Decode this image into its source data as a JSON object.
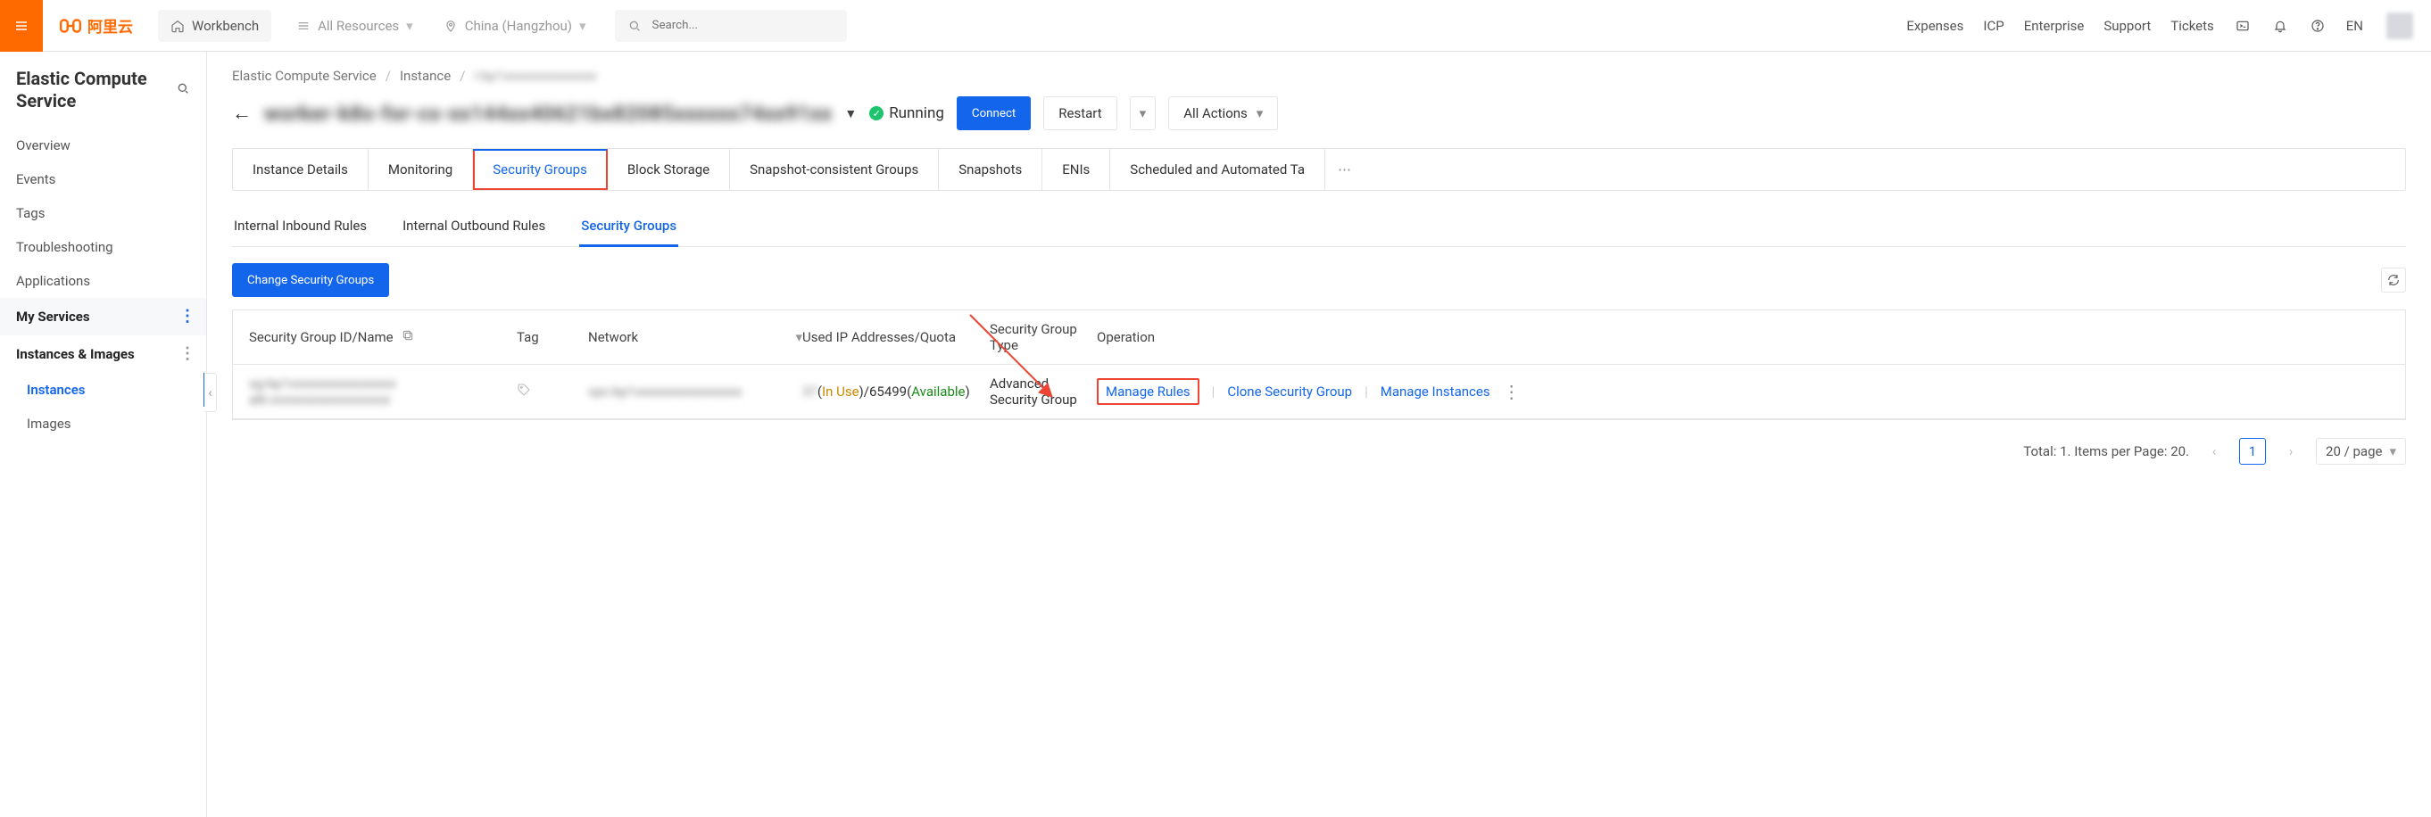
{
  "top": {
    "brand": "阿里云",
    "workbench": "Workbench",
    "all_resources": "All Resources",
    "region": "China (Hangzhou)",
    "search_placeholder": "Search...",
    "nav": {
      "expenses": "Expenses",
      "icp": "ICP",
      "enterprise": "Enterprise",
      "support": "Support",
      "tickets": "Tickets",
      "lang": "EN"
    }
  },
  "sidebar": {
    "title": "Elastic Compute Service",
    "items": {
      "overview": "Overview",
      "events": "Events",
      "tags": "Tags",
      "troubleshooting": "Troubleshooting",
      "applications": "Applications"
    },
    "my_services": "My Services",
    "instances_images": "Instances & Images",
    "instances": "Instances",
    "images": "Images"
  },
  "crumbs": {
    "a": "Elastic Compute Service",
    "b": "Instance",
    "c": "i-bp1xxxxxxxxxxxxxx"
  },
  "title": {
    "name": "worker-k8s-for-cs-xx144xx40621bx82085xxxxxx74xx91xx",
    "status": "Running",
    "connect": "Connect",
    "restart": "Restart",
    "all_actions": "All Actions"
  },
  "tabs1": {
    "details": "Instance Details",
    "monitoring": "Monitoring",
    "security_groups": "Security Groups",
    "block_storage": "Block Storage",
    "snapshot_groups": "Snapshot-consistent Groups",
    "snapshots": "Snapshots",
    "enis": "ENIs",
    "scheduled": "Scheduled and Automated Ta"
  },
  "tabs2": {
    "inbound": "Internal Inbound Rules",
    "outbound": "Internal Outbound Rules",
    "sg": "Security Groups"
  },
  "buttons": {
    "change_sg": "Change Security Groups"
  },
  "table": {
    "headers": {
      "id": "Security Group ID/Name",
      "tag": "Tag",
      "network": "Network",
      "ip": "Used IP Addresses/Quota",
      "type": "Security Group Type",
      "op": "Operation"
    },
    "row": {
      "id_line1": "sg-bp1xxxxxxxxxxxxxxxx",
      "id_line2": "alb-xxxxxxxxxxxxxxxxxx",
      "network": "vpc-bp1xxxxxxxxxxxxxxxx",
      "ip_used_prefix": "37",
      "ip_inuse": "In Use",
      "ip_total": "/65499",
      "ip_avail": "Available",
      "type": "Advanced Security Group",
      "op_manage_rules": "Manage Rules",
      "op_clone": "Clone Security Group",
      "op_manage_instances": "Manage Instances"
    }
  },
  "pager": {
    "summary": "Total: 1. Items per Page: 20.",
    "page": "1",
    "pagesize": "20 / page"
  }
}
